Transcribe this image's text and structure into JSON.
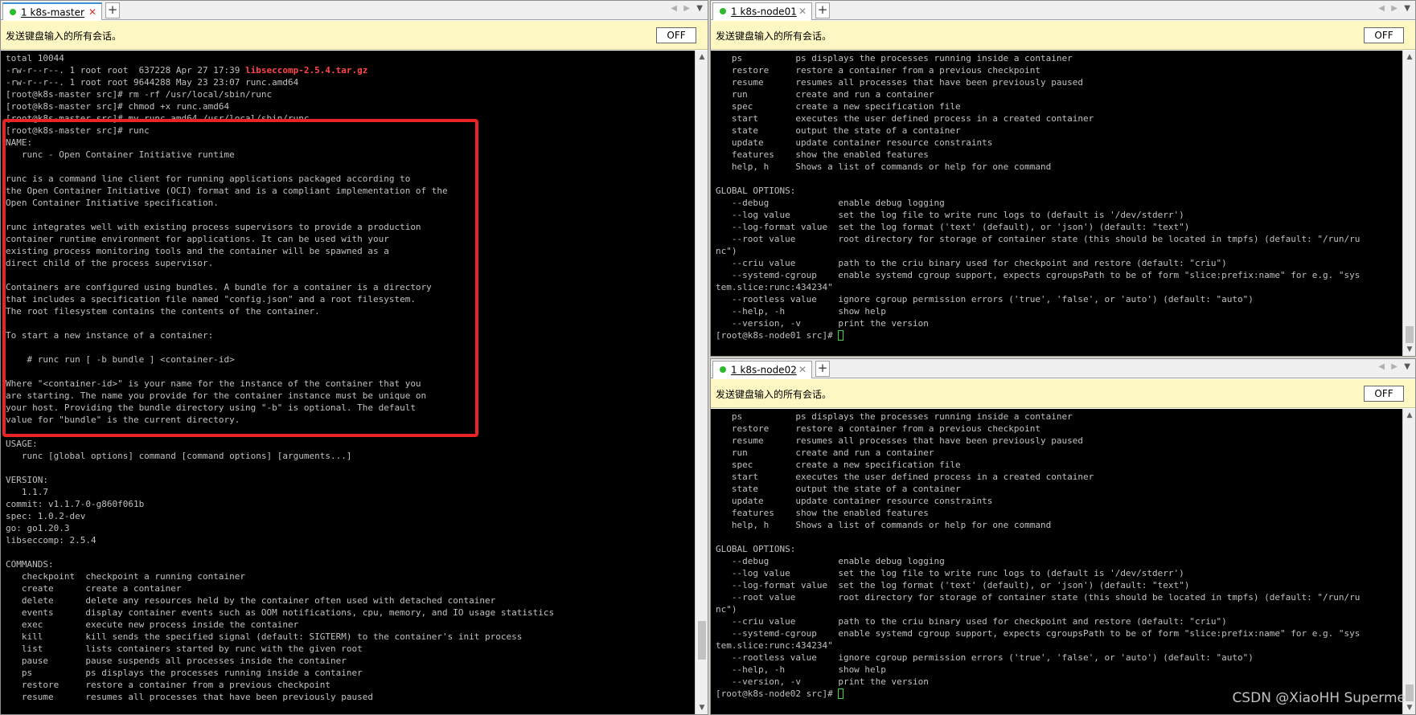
{
  "panes": {
    "master": {
      "tab_label": "1 k8s-master",
      "broadcast_text": "发送键盘输入的所有会话。",
      "broadcast_button": "OFF",
      "scroll_level": 0.93,
      "terminal_lines": [
        "total 10044",
        "-rw-r--r--. 1 root root  637228 Apr 27 17:39 ",
        "-rw-r--r--. 1 root root 9644288 May 23 23:07 runc.amd64",
        "[root@k8s-master src]# rm -rf /usr/local/sbin/runc",
        "[root@k8s-master src]# chmod +x runc.amd64",
        "[root@k8s-master src]# mv runc.amd64 /usr/local/sbin/runc",
        "[root@k8s-master src]# runc",
        "NAME:",
        "   runc - Open Container Initiative runtime",
        "",
        "runc is a command line client for running applications packaged according to",
        "the Open Container Initiative (OCI) format and is a compliant implementation of the",
        "Open Container Initiative specification.",
        "",
        "runc integrates well with existing process supervisors to provide a production",
        "container runtime environment for applications. It can be used with your",
        "existing process monitoring tools and the container will be spawned as a",
        "direct child of the process supervisor.",
        "",
        "Containers are configured using bundles. A bundle for a container is a directory",
        "that includes a specification file named \"config.json\" and a root filesystem.",
        "The root filesystem contains the contents of the container.",
        "",
        "To start a new instance of a container:",
        "",
        "    # runc run [ -b bundle ] <container-id>",
        "",
        "Where \"<container-id>\" is your name for the instance of the container that you",
        "are starting. The name you provide for the container instance must be unique on",
        "your host. Providing the bundle directory using \"-b\" is optional. The default",
        "value for \"bundle\" is the current directory.",
        "",
        "USAGE:",
        "   runc [global options] command [command options] [arguments...]",
        "",
        "VERSION:",
        "   1.1.7",
        "commit: v1.1.7-0-g860f061b",
        "spec: 1.0.2-dev",
        "go: go1.20.3",
        "libseccomp: 2.5.4",
        "",
        "COMMANDS:",
        "   checkpoint  checkpoint a running container",
        "   create      create a container",
        "   delete      delete any resources held by the container often used with detached container",
        "   events      display container events such as OOM notifications, cpu, memory, and IO usage statistics",
        "   exec        execute new process inside the container",
        "   kill        kill sends the specified signal (default: SIGTERM) to the container's init process",
        "   list        lists containers started by runc with the given root",
        "   pause       pause suspends all processes inside the container",
        "   ps          ps displays the processes running inside a container",
        "   restore     restore a container from a previous checkpoint",
        "   resume      resumes all processes that have been previously paused"
      ],
      "highlighted_file": "libseccomp-2.5.4.tar.gz"
    },
    "node01": {
      "tab_label": "1 k8s-node01",
      "broadcast_text": "发送键盘输入的所有会话。",
      "broadcast_button": "OFF",
      "scroll_level": 1.0,
      "terminal_lines": [
        "   ps          ps displays the processes running inside a container",
        "   restore     restore a container from a previous checkpoint",
        "   resume      resumes all processes that have been previously paused",
        "   run         create and run a container",
        "   spec        create a new specification file",
        "   start       executes the user defined process in a created container",
        "   state       output the state of a container",
        "   update      update container resource constraints",
        "   features    show the enabled features",
        "   help, h     Shows a list of commands or help for one command",
        "",
        "GLOBAL OPTIONS:",
        "   --debug             enable debug logging",
        "   --log value         set the log file to write runc logs to (default is '/dev/stderr')",
        "   --log-format value  set the log format ('text' (default), or 'json') (default: \"text\")",
        "   --root value        root directory for storage of container state (this should be located in tmpfs) (default: \"/run/ru",
        "nc\")",
        "   --criu value        path to the criu binary used for checkpoint and restore (default: \"criu\")",
        "   --systemd-cgroup    enable systemd cgroup support, expects cgroupsPath to be of form \"slice:prefix:name\" for e.g. \"sys",
        "tem.slice:runc:434234\"",
        "   --rootless value    ignore cgroup permission errors ('true', 'false', or 'auto') (default: \"auto\")",
        "   --help, -h          show help",
        "   --version, -v       print the version"
      ],
      "prompt": "[root@k8s-node01 src]# "
    },
    "node02": {
      "tab_label": "1 k8s-node02",
      "broadcast_text": "发送键盘输入的所有会话。",
      "broadcast_button": "OFF",
      "scroll_level": 1.0,
      "terminal_lines": [
        "   ps          ps displays the processes running inside a container",
        "   restore     restore a container from a previous checkpoint",
        "   resume      resumes all processes that have been previously paused",
        "   run         create and run a container",
        "   spec        create a new specification file",
        "   start       executes the user defined process in a created container",
        "   state       output the state of a container",
        "   update      update container resource constraints",
        "   features    show the enabled features",
        "   help, h     Shows a list of commands or help for one command",
        "",
        "GLOBAL OPTIONS:",
        "   --debug             enable debug logging",
        "   --log value         set the log file to write runc logs to (default is '/dev/stderr')",
        "   --log-format value  set the log format ('text' (default), or 'json') (default: \"text\")",
        "   --root value        root directory for storage of container state (this should be located in tmpfs) (default: \"/run/ru",
        "nc\")",
        "   --criu value        path to the criu binary used for checkpoint and restore (default: \"criu\")",
        "   --systemd-cgroup    enable systemd cgroup support, expects cgroupsPath to be of form \"slice:prefix:name\" for e.g. \"sys",
        "tem.slice:runc:434234\"",
        "   --rootless value    ignore cgroup permission errors ('true', 'false', or 'auto') (default: \"auto\")",
        "   --help, -h          show help",
        "   --version, -v       print the version"
      ],
      "prompt": "[root@k8s-node02 src]# "
    }
  },
  "watermark": "CSDN @XiaoHH Superme",
  "colors": {
    "terminal_bg": "#000000",
    "terminal_fg": "#c0c0c0",
    "file_highlight": "#ff4646",
    "annotation_box": "#e82424",
    "broadcast_bg": "#fdf7c4",
    "cursor": "#3cd83c",
    "session_dot": "#2dbb2d"
  },
  "icons": {
    "session_status": "green-dot-icon",
    "close_tab": "close-icon",
    "new_tab": "plus-icon",
    "tab_prev": "chevron-left-icon",
    "tab_next": "chevron-right-icon",
    "tab_menu": "chevron-down-icon"
  }
}
